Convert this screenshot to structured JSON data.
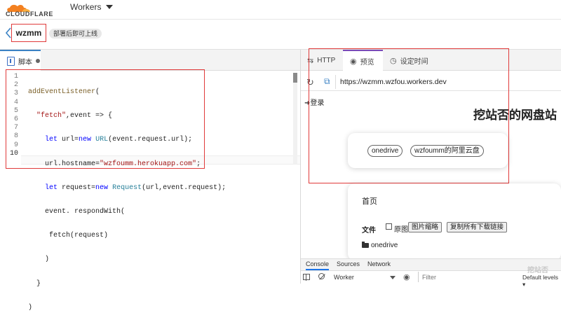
{
  "header": {
    "logo_text": "CLOUDFLARE",
    "menu_label": "Workers"
  },
  "worker": {
    "name": "wzmm",
    "badge": "部署后即可上线"
  },
  "editor": {
    "tab_label": "脚本",
    "line_numbers": [
      "1",
      "2",
      "3",
      "4",
      "5",
      "6",
      "7",
      "8",
      "9",
      "10"
    ]
  },
  "preview": {
    "tabs": [
      "HTTP",
      "预览",
      "设定时间"
    ],
    "url": "https://wzmm.wzfou.workers.dev",
    "login": "登录",
    "site_title": "挖站否的网盘站",
    "drive_buttons": [
      "onedrive",
      "wzfoumm的阿里云盘"
    ],
    "home": "首页",
    "file_label": "文件",
    "original_label": "原图",
    "thumb_button": "图片缩略",
    "copy_button": "复制所有下载链接",
    "folder": "onedrive"
  },
  "console": {
    "tabs": [
      "Console",
      "Sources",
      "Network"
    ],
    "context": "Worker",
    "filter_placeholder": "Filter",
    "levels": "Default levels"
  },
  "watermark": "挖站否",
  "colors": {
    "highlight_box": "#e03a3a",
    "active_tab_blue": "#3b82c4",
    "active_tab_purple": "#7a4ab8",
    "logo_orange": "#f38020"
  }
}
